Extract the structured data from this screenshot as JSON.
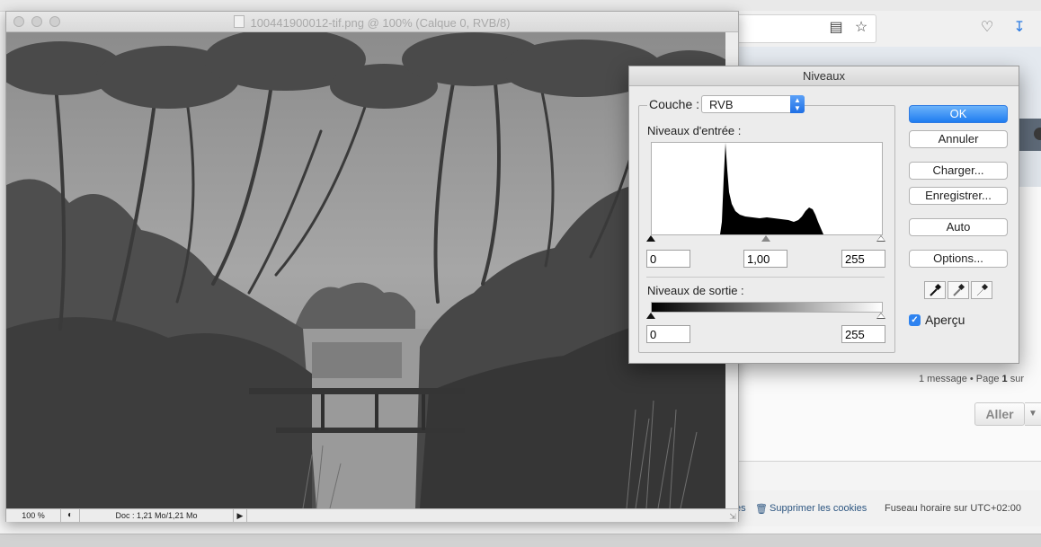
{
  "document_window": {
    "title": "100441900012-tif.png @ 100% (Calque 0, RVB/8)",
    "status": {
      "zoom": "100 %",
      "doc_info": "Doc : 1,21 Mo/1,21 Mo"
    }
  },
  "levels_dialog": {
    "title": "Niveaux",
    "channel_label": "Couche :",
    "channel_value": "RVB",
    "input_levels_label": "Niveaux d'entrée :",
    "input_black": "0",
    "input_gamma": "1,00",
    "input_white": "255",
    "output_levels_label": "Niveaux de sortie :",
    "output_black": "0",
    "output_white": "255",
    "buttons": {
      "ok": "OK",
      "cancel": "Annuler",
      "load": "Charger...",
      "save": "Enregistrer...",
      "auto": "Auto",
      "options": "Options..."
    },
    "preview_label": "Aperçu",
    "preview_checked": true,
    "accent_color": "#1f7cf0"
  },
  "browser": {
    "pagination": {
      "prefix": "1 message • Page ",
      "current": "1",
      "suffix": " sur"
    },
    "aller_button": "Aller",
    "footer": {
      "partial": "es",
      "delete_cookies": "Supprimer les cookies",
      "timezone": "Fuseau horaire sur UTC+02:00"
    }
  }
}
